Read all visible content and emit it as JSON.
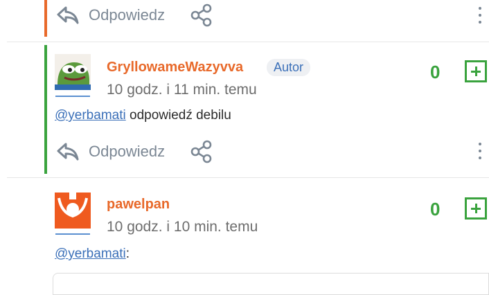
{
  "colors": {
    "accent_orange": "#e8692a",
    "accent_green": "#3aa33e",
    "mention_blue": "#3a6fb8",
    "muted_gray": "#7b8794"
  },
  "top_comment": {
    "reply_label": "Odpowiedz"
  },
  "comments": [
    {
      "username": "GryllowameWazyvva",
      "badge": "Autor",
      "timestamp": "10 godz. i 11 min. temu",
      "mention": "@yerbamati",
      "body": " odpowiedź debilu",
      "votes": "0",
      "reply_label": "Odpowiedz",
      "avatar_icon": "pepe-frog-avatar"
    },
    {
      "username": "pawelpan",
      "timestamp": "10 godz. i 10 min. temu",
      "mention": "@yerbamati",
      "body": ":",
      "votes": "0",
      "avatar_icon": "orange-figure-avatar"
    }
  ]
}
